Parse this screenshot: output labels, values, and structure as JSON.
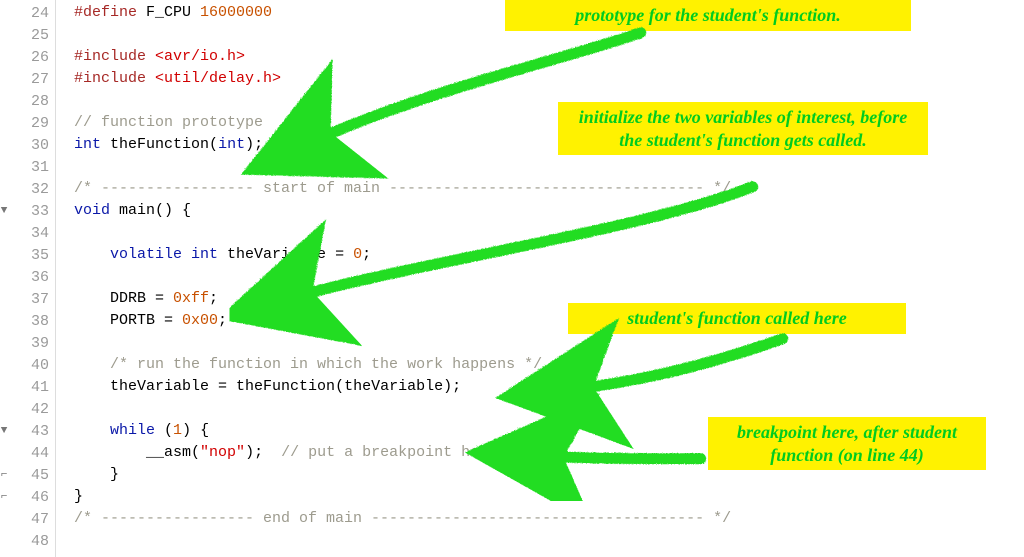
{
  "lines": [
    {
      "n": 24,
      "fold": "",
      "tokens": [
        [
          "mac",
          "#define "
        ],
        [
          "ident",
          "F_CPU "
        ],
        [
          "num",
          "16000000"
        ]
      ]
    },
    {
      "n": 25,
      "fold": "",
      "tokens": []
    },
    {
      "n": 26,
      "fold": "",
      "tokens": [
        [
          "mac",
          "#include "
        ],
        [
          "inc",
          "<avr/io.h>"
        ]
      ]
    },
    {
      "n": 27,
      "fold": "",
      "tokens": [
        [
          "mac",
          "#include "
        ],
        [
          "inc",
          "<util/delay.h>"
        ]
      ]
    },
    {
      "n": 28,
      "fold": "",
      "tokens": []
    },
    {
      "n": 29,
      "fold": "",
      "tokens": [
        [
          "comm",
          "// function prototype"
        ]
      ]
    },
    {
      "n": 30,
      "fold": "",
      "tokens": [
        [
          "type",
          "int "
        ],
        [
          "func",
          "theFunction"
        ],
        [
          "punct",
          "("
        ],
        [
          "type",
          "int"
        ],
        [
          "punct",
          ");"
        ]
      ]
    },
    {
      "n": 31,
      "fold": "",
      "tokens": []
    },
    {
      "n": 32,
      "fold": "",
      "tokens": [
        [
          "comm",
          "/* ----------------- start of main ----------------------------------- */"
        ]
      ]
    },
    {
      "n": 33,
      "fold": "▼",
      "tokens": [
        [
          "type",
          "void "
        ],
        [
          "func",
          "main"
        ],
        [
          "punct",
          "() {"
        ]
      ]
    },
    {
      "n": 34,
      "fold": "",
      "tokens": []
    },
    {
      "n": 35,
      "fold": "",
      "tokens": [
        [
          "ident",
          "    "
        ],
        [
          "kw",
          "volatile "
        ],
        [
          "type",
          "int "
        ],
        [
          "ident",
          "theVariable = "
        ],
        [
          "num",
          "0"
        ],
        [
          "punct",
          ";"
        ]
      ]
    },
    {
      "n": 36,
      "fold": "",
      "tokens": []
    },
    {
      "n": 37,
      "fold": "",
      "tokens": [
        [
          "ident",
          "    DDRB = "
        ],
        [
          "num",
          "0xff"
        ],
        [
          "punct",
          ";"
        ]
      ]
    },
    {
      "n": 38,
      "fold": "",
      "tokens": [
        [
          "ident",
          "    PORTB = "
        ],
        [
          "num",
          "0x00"
        ],
        [
          "punct",
          ";"
        ]
      ]
    },
    {
      "n": 39,
      "fold": "",
      "tokens": []
    },
    {
      "n": 40,
      "fold": "",
      "tokens": [
        [
          "ident",
          "    "
        ],
        [
          "comm",
          "/* run the function in which the work happens */"
        ]
      ]
    },
    {
      "n": 41,
      "fold": "",
      "tokens": [
        [
          "ident",
          "    theVariable = "
        ],
        [
          "func",
          "theFunction"
        ],
        [
          "punct",
          "(theVariable);"
        ]
      ]
    },
    {
      "n": 42,
      "fold": "",
      "tokens": []
    },
    {
      "n": 43,
      "fold": "▼",
      "tokens": [
        [
          "ident",
          "    "
        ],
        [
          "kw",
          "while "
        ],
        [
          "punct",
          "("
        ],
        [
          "num",
          "1"
        ],
        [
          "punct",
          ") {"
        ]
      ]
    },
    {
      "n": 44,
      "fold": "",
      "tokens": [
        [
          "ident",
          "        "
        ],
        [
          "func",
          "__asm"
        ],
        [
          "punct",
          "("
        ],
        [
          "str",
          "\"nop\""
        ],
        [
          "punct",
          ");  "
        ],
        [
          "comm",
          "// put a breakpoint here."
        ]
      ]
    },
    {
      "n": 45,
      "fold": "⌐",
      "tokens": [
        [
          "ident",
          "    "
        ],
        [
          "punct",
          "}"
        ]
      ]
    },
    {
      "n": 46,
      "fold": "⌐",
      "tokens": [
        [
          "punct",
          "}"
        ]
      ]
    },
    {
      "n": 47,
      "fold": "",
      "tokens": [
        [
          "comm",
          "/* ----------------- end of main ------------------------------------- */"
        ]
      ]
    },
    {
      "n": 48,
      "fold": "",
      "tokens": []
    }
  ],
  "annotations": {
    "a1": "prototype for the student's function.",
    "a2": "initialize the two variables of\ninterest, before the student's\nfunction gets called.",
    "a3": "student's function called here",
    "a4": "breakpoint here, after\nstudent function\n(on line 44)"
  },
  "colors": {
    "annot_bg": "#fff200",
    "annot_fg": "#00cc1f",
    "arrow": "#22dd22"
  }
}
